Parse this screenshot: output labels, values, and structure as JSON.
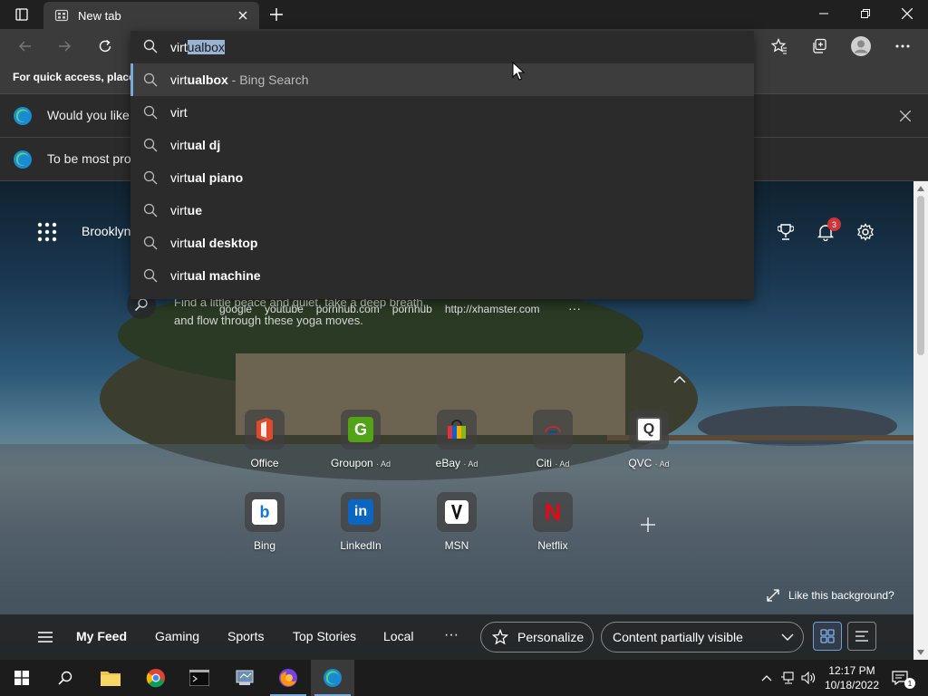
{
  "tab": {
    "title": "New tab"
  },
  "address": {
    "typed": "virt",
    "completion": "ualbox"
  },
  "suggestions": [
    {
      "typed": "virt",
      "completion": "ualbox",
      "source": " - Bing Search"
    },
    {
      "typed": "virt",
      "completion": "",
      "source": ""
    },
    {
      "typed": "virt",
      "completion": "ual dj",
      "source": ""
    },
    {
      "typed": "virt",
      "completion": "ual piano",
      "source": ""
    },
    {
      "typed": "virt",
      "completion": "ue",
      "source": ""
    },
    {
      "typed": "virt",
      "completion": "ual desktop",
      "source": ""
    },
    {
      "typed": "virt",
      "completion": "ual machine",
      "source": ""
    }
  ],
  "favbar": {
    "text": "For quick access, place y"
  },
  "infobars": [
    {
      "text": "Would you like t"
    },
    {
      "text": "To be most proc"
    }
  ],
  "ntp": {
    "location": "Brooklyn",
    "notification_count": "3",
    "caption": "Find a little peace and quiet, take a deep breath, and flow through these yoga moves.",
    "quick_links": [
      "google",
      "youtube",
      "pornhub.com",
      "pornhub",
      "http://xhamster.com"
    ],
    "more": "···",
    "tiles_row1": [
      {
        "label": "Office",
        "ad": ""
      },
      {
        "label": "Groupon",
        "ad": "· Ad"
      },
      {
        "label": "eBay",
        "ad": "· Ad"
      },
      {
        "label": "Citi",
        "ad": "· Ad"
      },
      {
        "label": "QVC",
        "ad": "· Ad"
      }
    ],
    "tiles_row2": [
      {
        "label": "Bing",
        "ad": ""
      },
      {
        "label": "LinkedIn",
        "ad": ""
      },
      {
        "label": "MSN",
        "ad": ""
      },
      {
        "label": "Netflix",
        "ad": ""
      }
    ],
    "like_background": "Like this background?"
  },
  "feed": {
    "links": [
      "My Feed",
      "Gaming",
      "Sports",
      "Top Stories",
      "Local"
    ],
    "more": "···",
    "personalize": "Personalize",
    "content_select": "Content partially visible"
  },
  "taskbar": {
    "time": "12:17 PM",
    "date": "10/18/2022",
    "notifications": "1"
  },
  "colors": {
    "accent": "#78a8d8",
    "selection": "#9ab3d3",
    "badge": "#d13438"
  }
}
